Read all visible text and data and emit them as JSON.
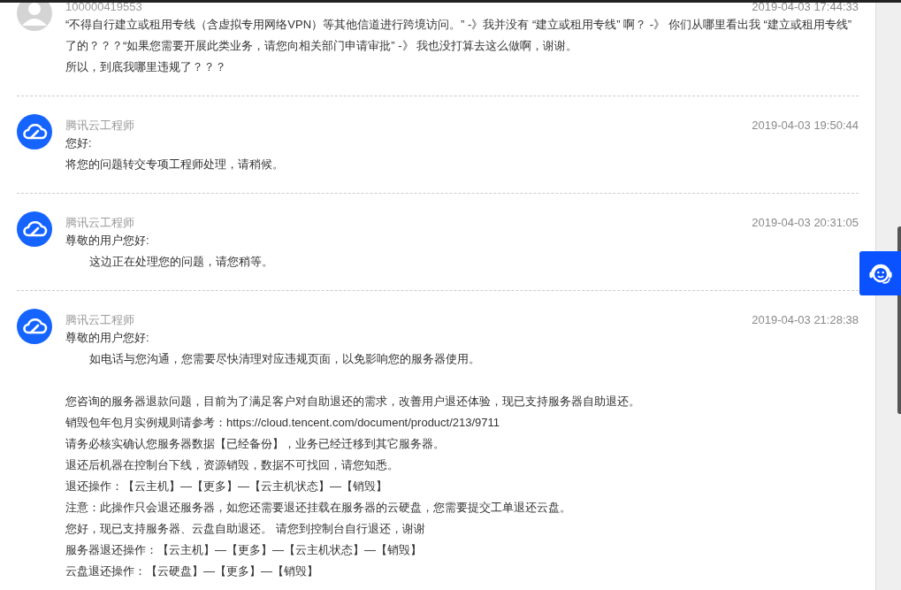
{
  "messages": [
    {
      "sender": "100000419553",
      "kind": "user",
      "time": "2019-04-03 17:44:33",
      "paragraphs": [
        {
          "lines": [
            {
              "text": "“不得自行建立或租用专线（含虚拟专用网络VPN）等其他信道进行跨境访问。” -》我并没有 “建立或租用专线” 啊？ -》 你们从哪里看出我 “建立或租用专线” 了的？？？“如果您需要开展此类业务，请您向相关部门申请审批” -》 我也没打算去这么做啊，谢谢。",
              "indent": false
            },
            {
              "text": "所以，到底我哪里违规了？？？",
              "indent": false
            }
          ]
        }
      ]
    },
    {
      "sender": "腾讯云工程师",
      "kind": "engineer",
      "time": "2019-04-03 19:50:44",
      "paragraphs": [
        {
          "lines": [
            {
              "text": "您好:",
              "indent": false
            },
            {
              "text": "将您的问题转交专项工程师处理，请稍候。",
              "indent": false
            }
          ]
        }
      ]
    },
    {
      "sender": "腾讯云工程师",
      "kind": "engineer",
      "time": "2019-04-03 20:31:05",
      "paragraphs": [
        {
          "lines": [
            {
              "text": "尊敬的用户您好:",
              "indent": false
            },
            {
              "text": "这边正在处理您的问题，请您稍等。",
              "indent": true
            }
          ]
        }
      ]
    },
    {
      "sender": "腾讯云工程师",
      "kind": "engineer",
      "time": "2019-04-03 21:28:38",
      "paragraphs": [
        {
          "lines": [
            {
              "text": "尊敬的用户您好:",
              "indent": false
            },
            {
              "text": "如电话与您沟通，您需要尽快清理对应违规页面，以免影响您的服务器使用。",
              "indent": true
            }
          ]
        },
        {
          "lines": [
            {
              "text": "您咨询的服务器退款问题，目前为了满足客户对自助退还的需求，改善用户退还体验，现已支持服务器自助退还。",
              "indent": false
            },
            {
              "text": "销毁包年包月实例规则请参考：https://cloud.tencent.com/document/product/213/9711",
              "indent": false
            },
            {
              "text": "请务必核实确认您服务器数据【已经备份】，业务已经迁移到其它服务器。",
              "indent": false
            },
            {
              "text": "退还后机器在控制台下线，资源销毁，数据不可找回，请您知悉。",
              "indent": false
            },
            {
              "text": "退还操作：【云主机】—【更多】—【云主机状态】—【销毁】",
              "indent": false
            },
            {
              "text": "注意：此操作只会退还服务器，如您还需要退还挂载在服务器的云硬盘，您需要提交工单退还云盘。",
              "indent": false
            },
            {
              "text": "您好，现已支持服务器、云盘自助退还。 请您到控制台自行退还，谢谢",
              "indent": false
            },
            {
              "text": "服务器退还操作：【云主机】—【更多】—【云主机状态】—【销毁】",
              "indent": false
            },
            {
              "text": "云盘退还操作：【云硬盘】—【更多】—【销毁】",
              "indent": false
            }
          ]
        }
      ]
    }
  ]
}
